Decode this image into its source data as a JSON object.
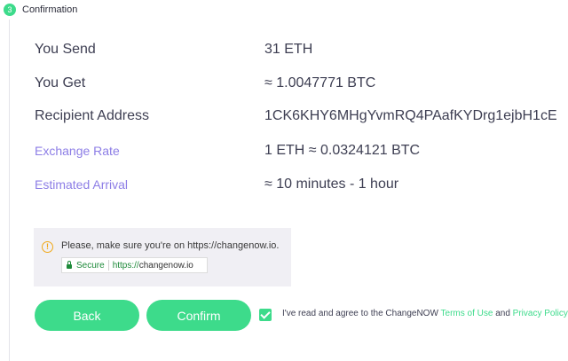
{
  "step": {
    "number": "3",
    "title": "Confirmation"
  },
  "details": [
    {
      "label": "You Send",
      "value": "31 ETH",
      "accent": false
    },
    {
      "label": "You Get",
      "value": "≈ 1.0047771 BTC",
      "accent": false
    },
    {
      "label": "Recipient Address",
      "value": "1CK6KHY6MHgYvmRQ4PAafKYDrg1ejbH1cE",
      "accent": false
    },
    {
      "label": "Exchange Rate",
      "value": "1 ETH  ≈ 0.0324121 BTC",
      "accent": true
    },
    {
      "label": "Estimated Arrival",
      "value": "≈ 10 minutes - 1 hour",
      "accent": true
    }
  ],
  "notice": {
    "text": "Please, make sure you're on https://changenow.io.",
    "secure_label": "Secure",
    "url_protocol": "https://",
    "url_host": "changenow.io"
  },
  "buttons": {
    "back": "Back",
    "confirm": "Confirm"
  },
  "agreement": {
    "checked": true,
    "text": "I've read and agree to the ChangeNOW ",
    "terms_link": "Terms of Use",
    "and": " and ",
    "privacy_link": "Privacy Policy"
  },
  "colors": {
    "accent_green": "#3ddb8b",
    "label_purple": "#8d7ee6",
    "text_dark": "#3d3e52"
  }
}
